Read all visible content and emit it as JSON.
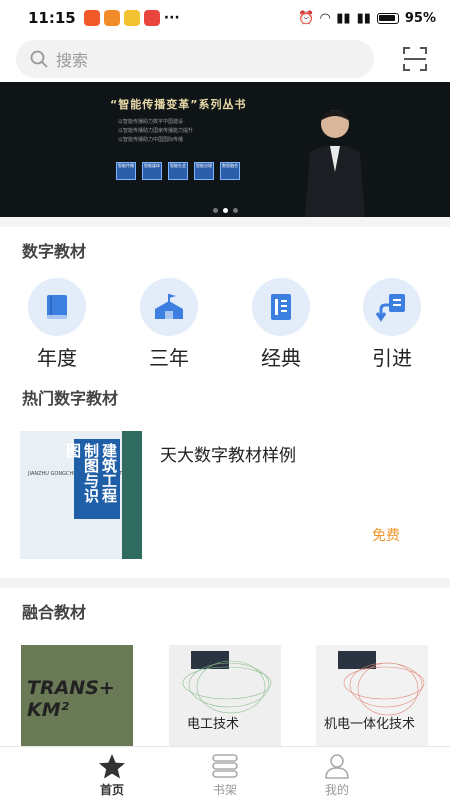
{
  "status_bar": {
    "time": "11:15",
    "battery": "95%",
    "more": "···"
  },
  "search": {
    "placeholder": "搜索"
  },
  "banner": {
    "title": "“智能传播变革”系列丛书",
    "lines": [
      "以智能传播助力数字中国建设",
      "以智能传播助力国家传播能力提升",
      "以智能传播助力中国国际传播"
    ],
    "boxes": [
      "智能传播",
      "智能媒体",
      "智能社会",
      "智能治理",
      "数智融合"
    ],
    "page_count": 3,
    "active_page": 2
  },
  "sections": {
    "digital": "数字教材",
    "hot": "热门数字教材",
    "fused": "融合教材"
  },
  "categories": [
    {
      "label": "年度",
      "icon": "book-icon"
    },
    {
      "label": "三年",
      "icon": "school-icon"
    },
    {
      "label": "经典",
      "icon": "classic-book-icon"
    },
    {
      "label": "引进",
      "icon": "import-icon"
    }
  ],
  "hot_book": {
    "name": "天大数字教材样例",
    "price": "免费",
    "cover_title": "建筑工程制图与识图",
    "cover_en": "JIANZHU GONGCHENG ZHITU YU SHITU"
  },
  "fused_books": [
    {
      "cover_text": "TRANS+ KM²"
    },
    {
      "cover_text": "电工技术"
    },
    {
      "cover_text": "机电一体化技术"
    }
  ],
  "tabs": [
    {
      "label": "首页",
      "icon": "star-icon",
      "active": true
    },
    {
      "label": "书架",
      "icon": "bookshelf-icon",
      "active": false
    },
    {
      "label": "我的",
      "icon": "person-icon",
      "active": false
    }
  ],
  "colors": {
    "accent_orange": "#f0962a",
    "icon_blue": "#3d7fe0",
    "icon_bg": "#e3ecf9"
  }
}
